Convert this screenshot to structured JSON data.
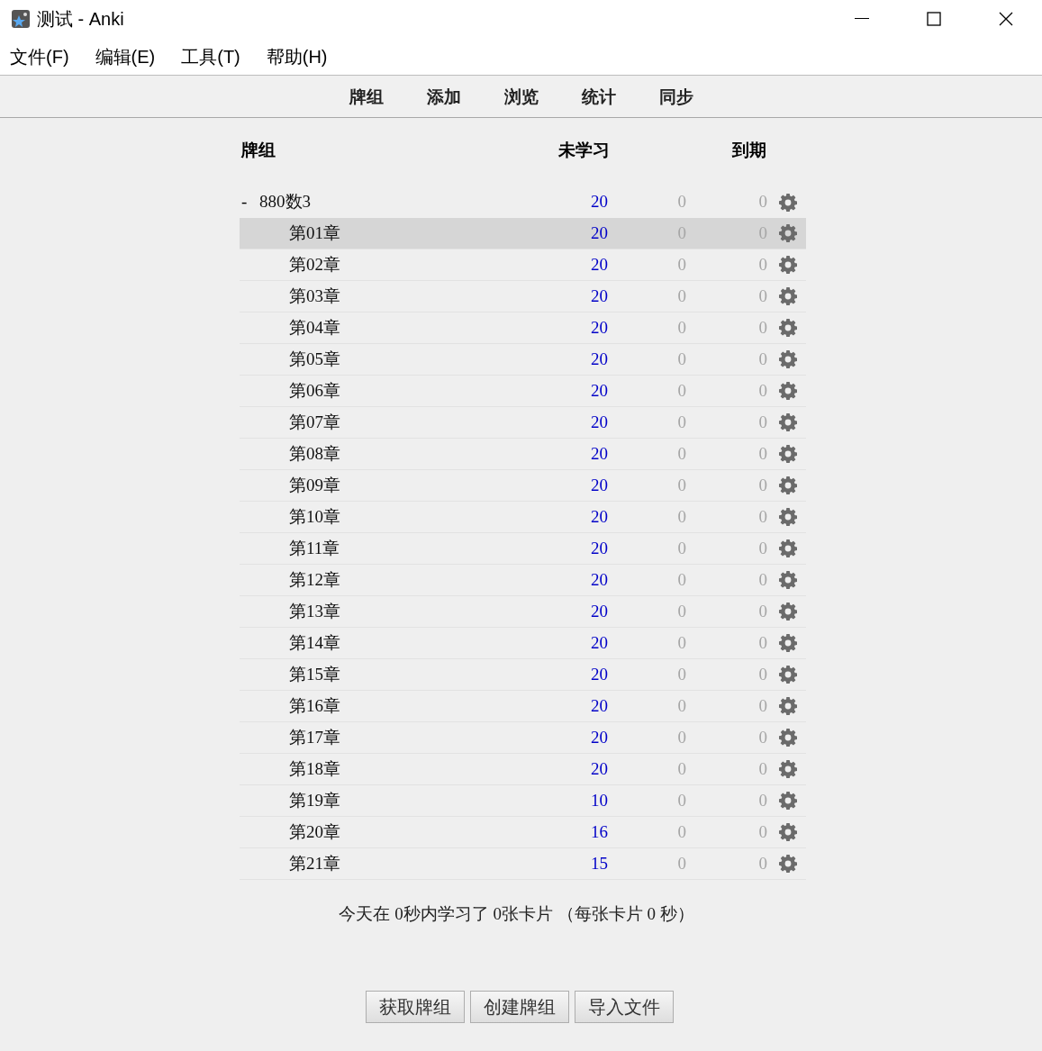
{
  "window": {
    "title": "测试 - Anki"
  },
  "menu": [
    "文件(F)",
    "编辑(E)",
    "工具(T)",
    "帮助(H)"
  ],
  "toolbar": [
    "牌组",
    "添加",
    "浏览",
    "统计",
    "同步"
  ],
  "table": {
    "columns": [
      "牌组",
      "未学习",
      "到期"
    ],
    "decks": [
      {
        "name": "880数3",
        "expanded": true,
        "selected": false,
        "new": "20",
        "learn": "0",
        "due": "0",
        "children": [
          {
            "name": "第01章",
            "selected": true,
            "new": "20",
            "learn": "0",
            "due": "0"
          },
          {
            "name": "第02章",
            "selected": false,
            "new": "20",
            "learn": "0",
            "due": "0"
          },
          {
            "name": "第03章",
            "selected": false,
            "new": "20",
            "learn": "0",
            "due": "0"
          },
          {
            "name": "第04章",
            "selected": false,
            "new": "20",
            "learn": "0",
            "due": "0"
          },
          {
            "name": "第05章",
            "selected": false,
            "new": "20",
            "learn": "0",
            "due": "0"
          },
          {
            "name": "第06章",
            "selected": false,
            "new": "20",
            "learn": "0",
            "due": "0"
          },
          {
            "name": "第07章",
            "selected": false,
            "new": "20",
            "learn": "0",
            "due": "0"
          },
          {
            "name": "第08章",
            "selected": false,
            "new": "20",
            "learn": "0",
            "due": "0"
          },
          {
            "name": "第09章",
            "selected": false,
            "new": "20",
            "learn": "0",
            "due": "0"
          },
          {
            "name": "第10章",
            "selected": false,
            "new": "20",
            "learn": "0",
            "due": "0"
          },
          {
            "name": "第11章",
            "selected": false,
            "new": "20",
            "learn": "0",
            "due": "0"
          },
          {
            "name": "第12章",
            "selected": false,
            "new": "20",
            "learn": "0",
            "due": "0"
          },
          {
            "name": "第13章",
            "selected": false,
            "new": "20",
            "learn": "0",
            "due": "0"
          },
          {
            "name": "第14章",
            "selected": false,
            "new": "20",
            "learn": "0",
            "due": "0"
          },
          {
            "name": "第15章",
            "selected": false,
            "new": "20",
            "learn": "0",
            "due": "0"
          },
          {
            "name": "第16章",
            "selected": false,
            "new": "20",
            "learn": "0",
            "due": "0"
          },
          {
            "name": "第17章",
            "selected": false,
            "new": "20",
            "learn": "0",
            "due": "0"
          },
          {
            "name": "第18章",
            "selected": false,
            "new": "20",
            "learn": "0",
            "due": "0"
          },
          {
            "name": "第19章",
            "selected": false,
            "new": "10",
            "learn": "0",
            "due": "0"
          },
          {
            "name": "第20章",
            "selected": false,
            "new": "16",
            "learn": "0",
            "due": "0"
          },
          {
            "name": "第21章",
            "selected": false,
            "new": "15",
            "learn": "0",
            "due": "0"
          }
        ]
      }
    ]
  },
  "expander": "-",
  "stats": "今天在 0秒内学习了 0张卡片 （每张卡片 0 秒）",
  "buttons": [
    "获取牌组",
    "创建牌组",
    "导入文件"
  ]
}
